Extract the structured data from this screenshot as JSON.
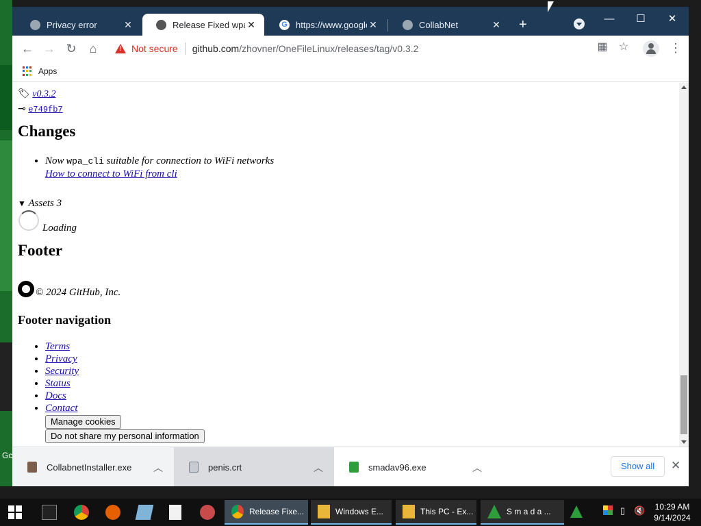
{
  "desktop": {
    "label": "Gc"
  },
  "browser": {
    "tabs": [
      {
        "title": "Privacy error",
        "active": false
      },
      {
        "title": "Release Fixed wpa_supplicant",
        "active": true
      },
      {
        "title": "https://www.google.com",
        "active": false
      },
      {
        "title": "CollabNet",
        "active": false
      }
    ],
    "new_tab": "+",
    "window_controls": {
      "minimize": "—",
      "maximize": "☐",
      "close": "✕"
    },
    "security_label": "Not secure",
    "url_host": "github.com",
    "url_path": "/zhovner/OneFileLinux/releases/tag/v0.3.2",
    "bookmarks": [
      {
        "label": "Apps"
      }
    ]
  },
  "page": {
    "tag": "v0.3.2",
    "commit": "e749fb7",
    "changes_heading": "Changes",
    "change_prefix": "Now ",
    "change_code": "wpa_cli",
    "change_suffix": " suitable for connection to WiFi networks",
    "change_link": "How to connect to WiFi from cli",
    "assets": "Assets 3",
    "loading": "Loading",
    "footer_heading": "Footer",
    "copyright": "© 2024 GitHub, Inc.",
    "footer_nav_heading": "Footer navigation",
    "footer_links": [
      "Terms",
      "Privacy",
      "Security",
      "Status",
      "Docs",
      "Contact"
    ],
    "manage_cookies": "Manage cookies",
    "do_not_share": "Do not share my personal information"
  },
  "downloads": {
    "items": [
      {
        "name": "CollabnetInstaller.exe",
        "icon": "installer-icon"
      },
      {
        "name": "penis.crt",
        "icon": "certificate-icon"
      },
      {
        "name": "smadav96.exe",
        "icon": "smadav-icon"
      }
    ],
    "show_all": "Show all"
  },
  "taskbar": {
    "apps": [
      {
        "label": "Release Fixe...",
        "icon": "chrome-icon",
        "active": true
      },
      {
        "label": "Windows E...",
        "icon": "folder-icon",
        "active": false
      },
      {
        "label": "This PC - Ex...",
        "icon": "folder-icon",
        "active": false
      },
      {
        "label": "S m a d a ...",
        "icon": "smadav-icon",
        "active": false
      }
    ],
    "time": "10:29 AM",
    "date": "9/14/2024"
  },
  "colors": {
    "tabstrip": "#1f3a57",
    "link": "#1a0dab",
    "warning": "#d93025",
    "accent": "#1a73e8"
  }
}
